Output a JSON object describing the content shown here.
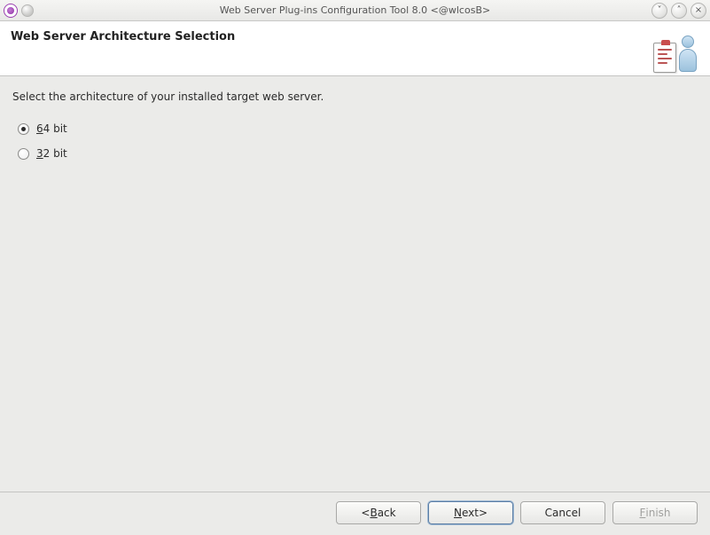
{
  "window": {
    "title": "Web Server Plug-ins Configuration Tool 8.0  <@wlcosB>"
  },
  "header": {
    "title": "Web Server Architecture Selection"
  },
  "main": {
    "instruction": "Select the architecture of your installed target web server.",
    "options": [
      {
        "mnemonic": "6",
        "rest": "4 bit",
        "selected": true
      },
      {
        "mnemonic": "3",
        "rest": "2 bit",
        "selected": false
      }
    ]
  },
  "footer": {
    "back": {
      "prefix": "< ",
      "mnemonic": "B",
      "rest": "ack"
    },
    "next": {
      "mnemonic": "N",
      "rest": "ext",
      "suffix": " >"
    },
    "cancel": {
      "label": "Cancel"
    },
    "finish": {
      "mnemonic": "F",
      "rest": "inish"
    }
  }
}
